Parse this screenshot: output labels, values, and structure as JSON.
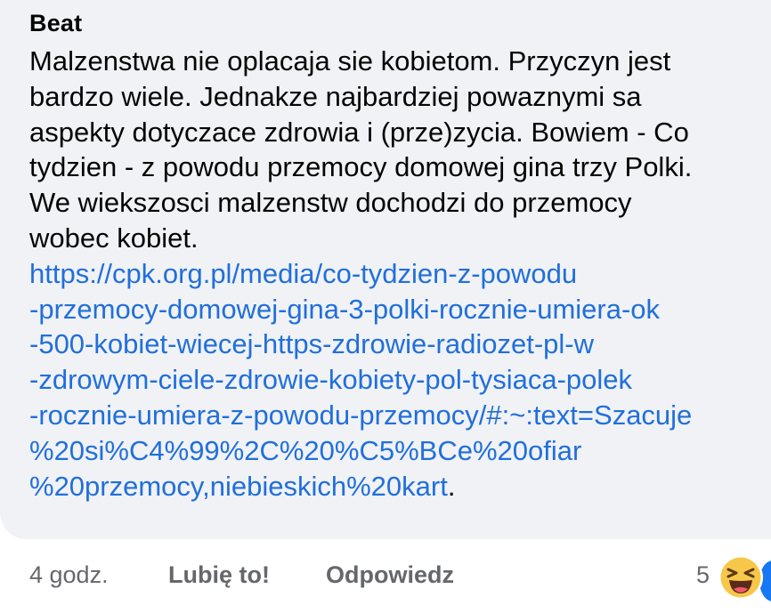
{
  "comment": {
    "author": "Beat",
    "text": "Malzenstwa nie oplacaja sie kobietom. Przyczyn jest\nbardzo wiele. Jednakze najbardziej powaznymi sa\naspekty dotyczace zdrowia i (prze)zycia.  Bowiem  - Co\ntydzien - z powodu przemocy domowej gina trzy Polki.\nWe wiekszosci malzenstw dochodzi do przemocy\nwobec kobiet.",
    "link": "https://cpk.org.pl/media/co-tydzien-z-powodu\n-przemocy-domowej-gina-3-polki-rocznie-umiera-ok\n-500-kobiet-wiecej-https-zdrowie-radiozet-pl-w\n-zdrowym-ciele-zdrowie-kobiety-pol-tysiaca-polek\n-rocznie-umiera-z-powodu-przemocy/#:~:text=Szacuje\n%20si%C4%99%2C%20%C5%BCe%20ofiar\n%20przemocy,niebieskich%20kart",
    "link_suffix": "."
  },
  "actions": {
    "time": "4 godz.",
    "like_label": "Lubię to!",
    "reply_label": "Odpowiedz",
    "reaction_count": "5"
  },
  "colors": {
    "bubble_bg": "#f0f2f5",
    "link": "#216fdb",
    "meta": "#65676b",
    "like_blue": "#1877f2"
  },
  "icons": {
    "reaction_primary": "laughing-emoji-icon",
    "reaction_secondary": "like-thumb-icon"
  }
}
